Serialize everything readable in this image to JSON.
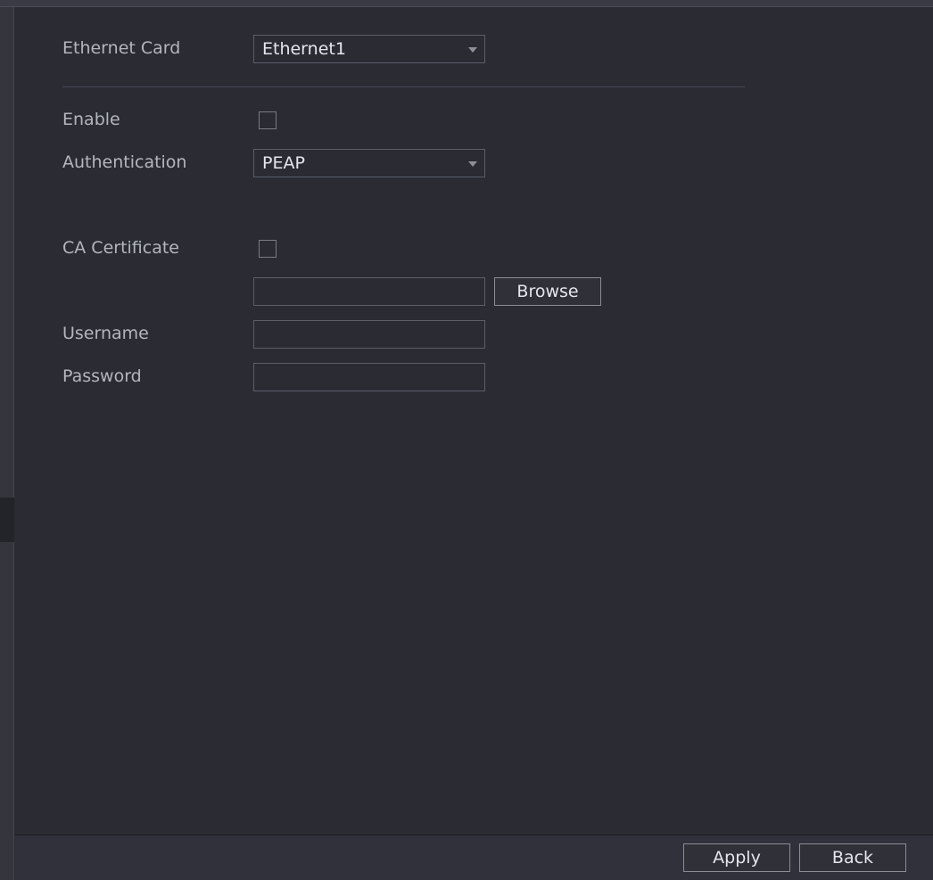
{
  "form": {
    "ethernet_card_label": "Ethernet Card",
    "ethernet_card_value": "Ethernet1",
    "enable_label": "Enable",
    "authentication_label": "Authentication",
    "authentication_value": "PEAP",
    "ca_certificate_label": "CA Certificate",
    "browse_label": "Browse",
    "username_label": "Username",
    "username_value": "",
    "password_label": "Password",
    "password_value": ""
  },
  "footer": {
    "apply_label": "Apply",
    "back_label": "Back"
  },
  "icons": {
    "dropdown": "chevron-down-icon"
  },
  "colors": {
    "background": "#2a2b33",
    "label_text": "#b3b6bf",
    "value_text": "#e6e7ec",
    "border": "#5c5e68"
  }
}
